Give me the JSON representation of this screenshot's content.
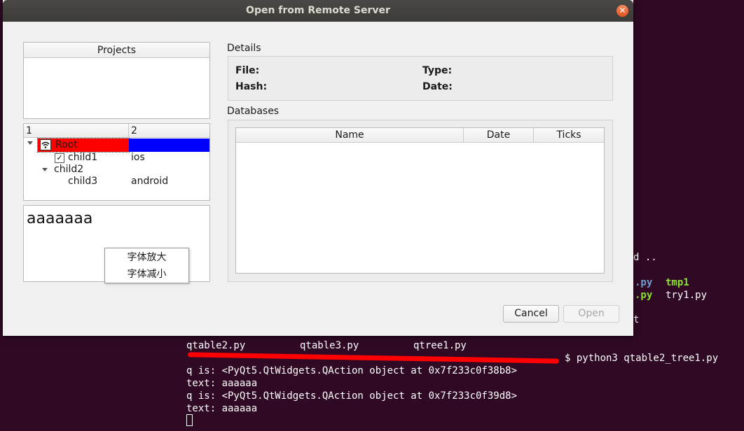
{
  "terminal": {
    "right_lines": [
      "d ..",
      ".py",
      "tmp1",
      ".py",
      "try1.py",
      "t"
    ],
    "files": [
      "qtable2.py",
      "qtable3.py",
      "qtree1.py"
    ],
    "prompt_suffix": "$ python3 qtable2_tree1.py",
    "output": [
      "q is: <PyQt5.QtWidgets.QAction object at 0x7f233c0f38b8>",
      "text: aaaaaa",
      "q is: <PyQt5.QtWidgets.QAction object at 0x7f233c0f39d8>",
      "text: aaaaaa"
    ]
  },
  "dialog": {
    "title": "Open from Remote Server",
    "projects_header": "Projects",
    "tree": {
      "columns": [
        "1",
        "2"
      ],
      "rows": [
        {
          "label": "Root",
          "col2": ""
        },
        {
          "label": "child1",
          "col2": "ios"
        },
        {
          "label": "child2",
          "col2": ""
        },
        {
          "label": "child3",
          "col2": "android"
        }
      ]
    },
    "text_area": "aaaaaaa",
    "context_menu": [
      "字体放大",
      "字体减小"
    ],
    "details": {
      "heading": "Details",
      "file_label": "File:",
      "type_label": "Type:",
      "hash_label": "Hash:",
      "date_label": "Date:"
    },
    "databases": {
      "heading": "Databases",
      "columns": [
        "Name",
        "Date",
        "Ticks"
      ]
    },
    "buttons": {
      "cancel": "Cancel",
      "open": "Open"
    }
  }
}
